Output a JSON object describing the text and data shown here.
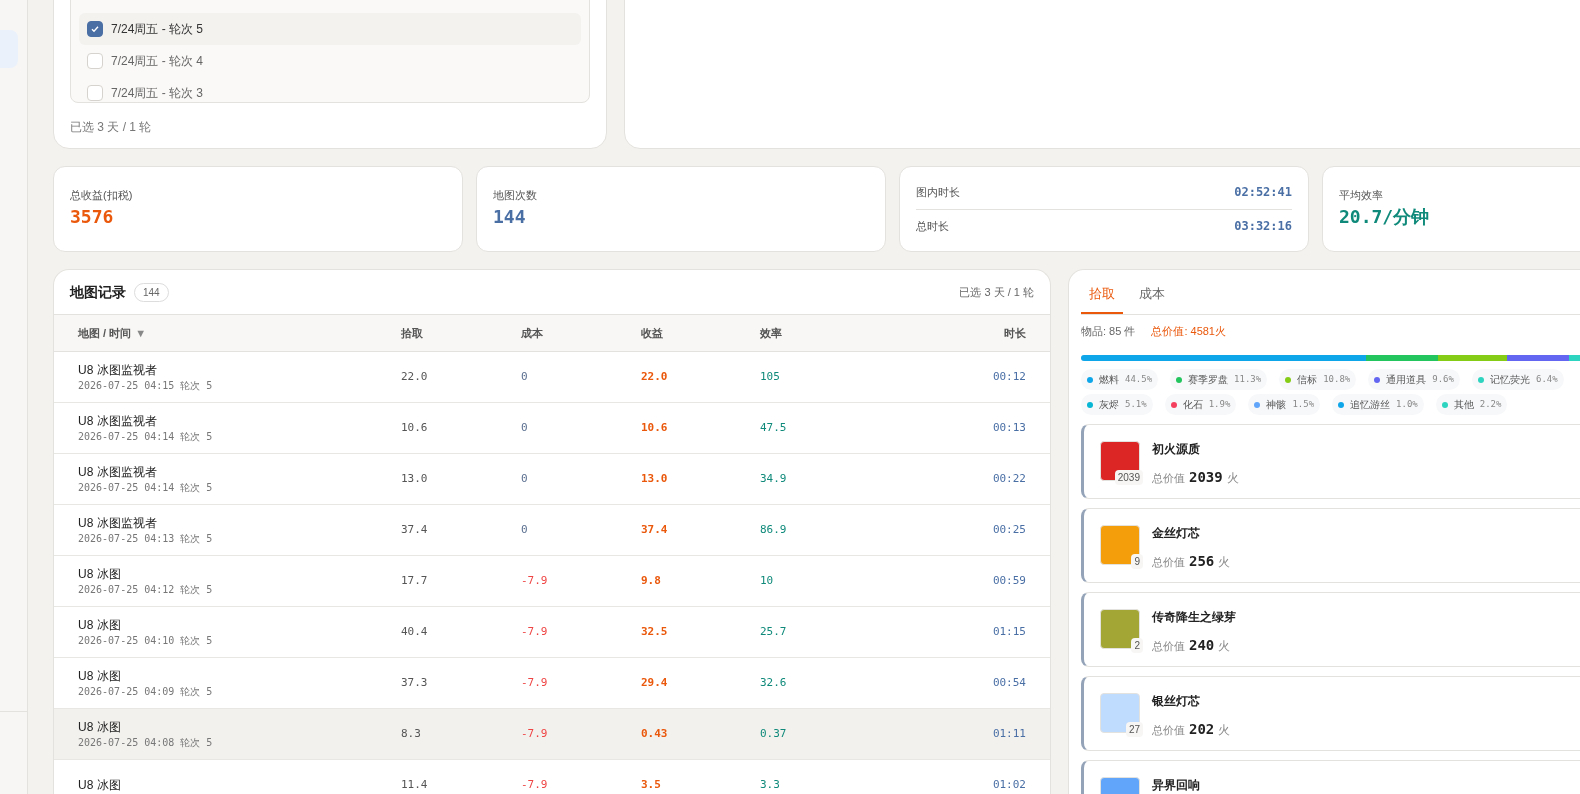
{
  "rounds": {
    "items": [
      {
        "label": "7/24周五 - 轮次 5",
        "checked": true
      },
      {
        "label": "7/24周五 - 轮次 4",
        "checked": false
      },
      {
        "label": "7/24周五 - 轮次 3",
        "checked": false
      }
    ],
    "summary": "已选 3 天 / 1 轮"
  },
  "stats": [
    {
      "kind": "value",
      "label": "总收益(扣税)",
      "value": "3576",
      "color": "#ea580c"
    },
    {
      "kind": "value",
      "label": "地图次数",
      "value": "144",
      "color": "#4a6fa5"
    },
    {
      "kind": "pairs",
      "rows": [
        {
          "label": "图内时长",
          "value": "02:52:41"
        },
        {
          "label": "总时长",
          "value": "03:32:16"
        }
      ]
    },
    {
      "kind": "value",
      "label": "平均效率",
      "value": "20.7/分钟",
      "color": "#0f8a7a"
    }
  ],
  "records": {
    "title": "地图记录",
    "count": "144",
    "selection": "已选 3 天 / 1 轮",
    "columns": [
      "地图 / 时间",
      "拾取",
      "成本",
      "收益",
      "效率",
      "时长"
    ],
    "sort_indicator": "▼",
    "rows": [
      {
        "map": "U8 冰图监视者",
        "time": "2026-07-25 04:15 轮次 5",
        "pickup": "22.0",
        "cost": "0",
        "cost_negative": false,
        "profit": "22.0",
        "efficiency": "105",
        "duration": "00:12",
        "highlighted": false
      },
      {
        "map": "U8 冰图监视者",
        "time": "2026-07-25 04:14 轮次 5",
        "pickup": "10.6",
        "cost": "0",
        "cost_negative": false,
        "profit": "10.6",
        "efficiency": "47.5",
        "duration": "00:13",
        "highlighted": false
      },
      {
        "map": "U8 冰图监视者",
        "time": "2026-07-25 04:14 轮次 5",
        "pickup": "13.0",
        "cost": "0",
        "cost_negative": false,
        "profit": "13.0",
        "efficiency": "34.9",
        "duration": "00:22",
        "highlighted": false
      },
      {
        "map": "U8 冰图监视者",
        "time": "2026-07-25 04:13 轮次 5",
        "pickup": "37.4",
        "cost": "0",
        "cost_negative": false,
        "profit": "37.4",
        "efficiency": "86.9",
        "duration": "00:25",
        "highlighted": false
      },
      {
        "map": "U8 冰图",
        "time": "2026-07-25 04:12 轮次 5",
        "pickup": "17.7",
        "cost": "-7.9",
        "cost_negative": true,
        "profit": "9.8",
        "efficiency": "10",
        "duration": "00:59",
        "highlighted": false
      },
      {
        "map": "U8 冰图",
        "time": "2026-07-25 04:10 轮次 5",
        "pickup": "40.4",
        "cost": "-7.9",
        "cost_negative": true,
        "profit": "32.5",
        "efficiency": "25.7",
        "duration": "01:15",
        "highlighted": false
      },
      {
        "map": "U8 冰图",
        "time": "2026-07-25 04:09 轮次 5",
        "pickup": "37.3",
        "cost": "-7.9",
        "cost_negative": true,
        "profit": "29.4",
        "efficiency": "32.6",
        "duration": "00:54",
        "highlighted": false
      },
      {
        "map": "U8 冰图",
        "time": "2026-07-25 04:08 轮次 5",
        "pickup": "8.3",
        "cost": "-7.9",
        "cost_negative": true,
        "profit": "0.43",
        "efficiency": "0.37",
        "duration": "01:11",
        "highlighted": true
      },
      {
        "map": "U8 冰图",
        "pickup": "11.4",
        "cost": "-7.9",
        "cost_negative": true,
        "profit": "3.5",
        "efficiency": "3.3",
        "duration": "01:02",
        "highlighted": false
      }
    ]
  },
  "loot": {
    "tabs": [
      {
        "label": "拾取",
        "selected": true
      },
      {
        "label": "成本",
        "selected": false
      }
    ],
    "item_count": "物品: 85 件",
    "total_value": "总价值: 4581火",
    "categories": [
      {
        "name": "燃料",
        "share": "44.5%",
        "color": "#0ea5e9"
      },
      {
        "name": "赛季罗盘",
        "share": "11.3%",
        "color": "#22c55e"
      },
      {
        "name": "信标",
        "share": "10.8%",
        "color": "#84cc16"
      },
      {
        "name": "通用道具",
        "share": "9.6%",
        "color": "#6366f1"
      },
      {
        "name": "记忆荧光",
        "share": "6.4%",
        "color": "#2dd4bf"
      },
      {
        "name": "灰烬",
        "share": "5.1%",
        "color": "#06b6d4"
      },
      {
        "name": "化石",
        "share": "1.9%",
        "color": "#f43f5e"
      },
      {
        "name": "神骸",
        "share": "1.5%",
        "color": "#60a5fa"
      },
      {
        "name": "追忆游丝",
        "share": "1.0%",
        "color": "#0ea5e9"
      },
      {
        "name": "其他",
        "share": "2.2%",
        "color": "#2dd4bf"
      }
    ],
    "items": [
      {
        "name": "初火源质",
        "count": "2039",
        "value_label": "总价值",
        "value": "2039",
        "unit": "火",
        "color": "#dc2626"
      },
      {
        "name": "金丝灯芯",
        "count": "9",
        "value_label": "总价值",
        "value": "256",
        "unit": "火",
        "color": "#f59e0b"
      },
      {
        "name": "传奇降生之绿芽",
        "count": "2",
        "value_label": "总价值",
        "value": "240",
        "unit": "火",
        "color": "#a3a635"
      },
      {
        "name": "银丝灯芯",
        "count": "27",
        "value_label": "总价值",
        "value": "202",
        "unit": "火",
        "color": "#bfdbfe"
      },
      {
        "name": "异界回响",
        "color": "#60a5fa"
      }
    ]
  }
}
